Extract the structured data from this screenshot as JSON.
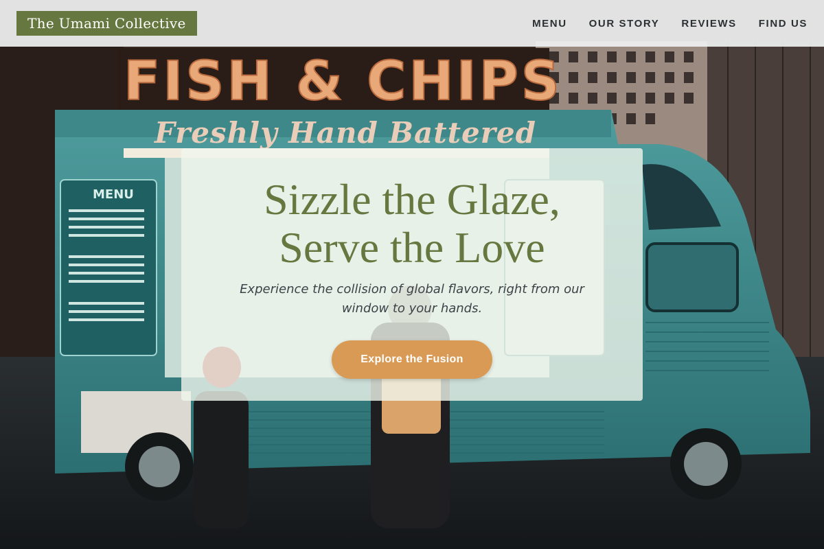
{
  "brand": {
    "name": "The Umami Collective",
    "color": "#66773f"
  },
  "nav": {
    "links": [
      {
        "label": "MENU"
      },
      {
        "label": "OUR STORY"
      },
      {
        "label": "REVIEWS"
      },
      {
        "label": "FIND US"
      }
    ]
  },
  "hero": {
    "title_line1": "Sizzle the Glaze,",
    "title_line2": "Serve the Love",
    "subtitle": "Experience the collision of global flavors, right from our window to your hands.",
    "cta_label": "Explore the Fusion",
    "cta_color": "#d99a55",
    "background_photo": {
      "sign_text": "FISH & CHIPS",
      "banner_text": "Freshly Hand Battered",
      "board_title": "MENU",
      "truck_color": "#3d8f91"
    }
  }
}
